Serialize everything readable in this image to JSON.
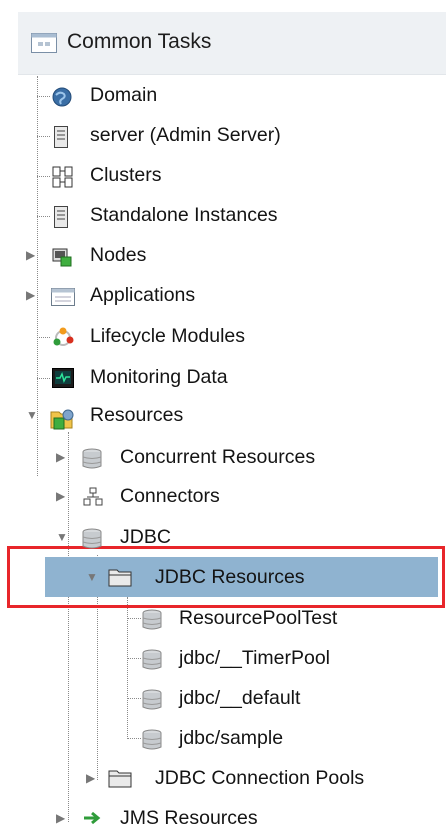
{
  "header": {
    "title": "Common Tasks"
  },
  "tree": {
    "domain": "Domain",
    "server": "server (Admin Server)",
    "clusters": "Clusters",
    "standalone": "Standalone Instances",
    "nodes": "Nodes",
    "applications": "Applications",
    "lifecycle": "Lifecycle Modules",
    "monitoring": "Monitoring Data",
    "resources": "Resources",
    "concurrent": "Concurrent Resources",
    "connectors": "Connectors",
    "jdbc": "JDBC",
    "jdbc_resources": "JDBC Resources",
    "pool_test": "ResourcePoolTest",
    "timer_pool": "jdbc/__TimerPool",
    "default": "jdbc/__default",
    "sample": "jdbc/sample",
    "connection_pools": "JDBC Connection Pools",
    "jms": "JMS Resources"
  },
  "colors": {
    "selection": "#8fb3d0",
    "annotation_box": "#e8262a"
  }
}
